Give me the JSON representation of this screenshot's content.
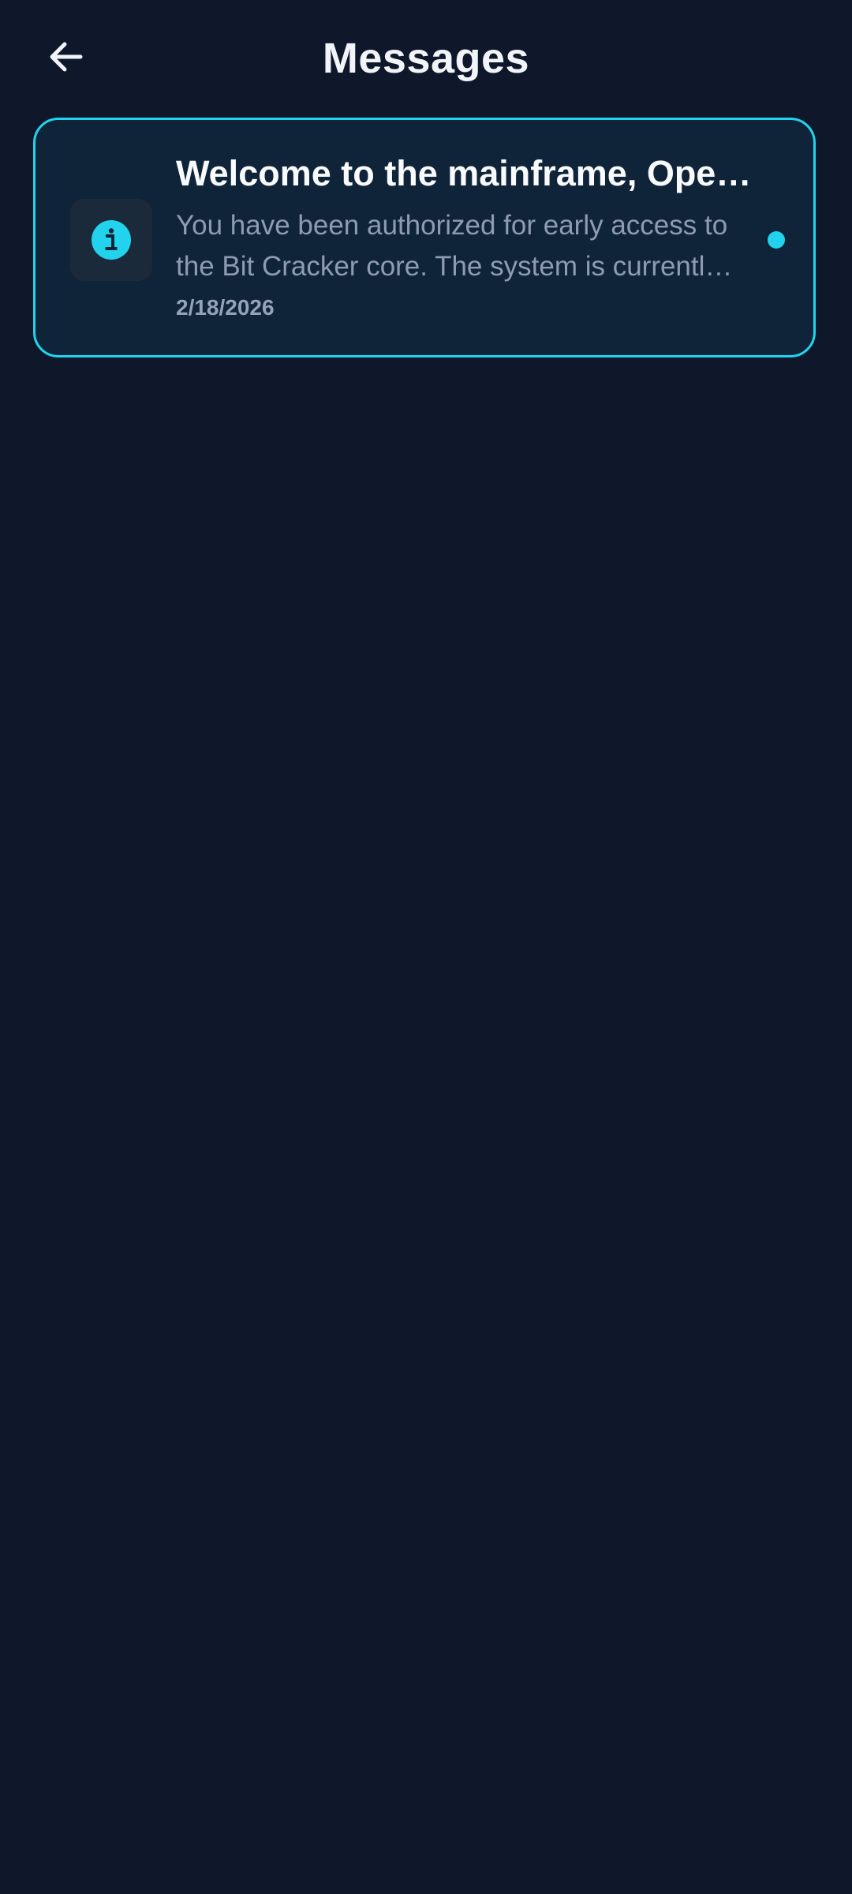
{
  "header": {
    "title": "Messages",
    "back_icon": "arrow-left-icon"
  },
  "messages": [
    {
      "icon": "info-icon",
      "title": "Welcome to the mainframe, Operator",
      "body": "You have been authorized for early access to the Bit Cracker core. The system is currently in beta.",
      "date": "2/18/2026",
      "unread": true
    }
  ],
  "colors": {
    "background": "#0f172a",
    "card": "#0f2438",
    "accent": "#22d3ee",
    "title": "#f8fafc",
    "body": "#8e9bb2"
  }
}
